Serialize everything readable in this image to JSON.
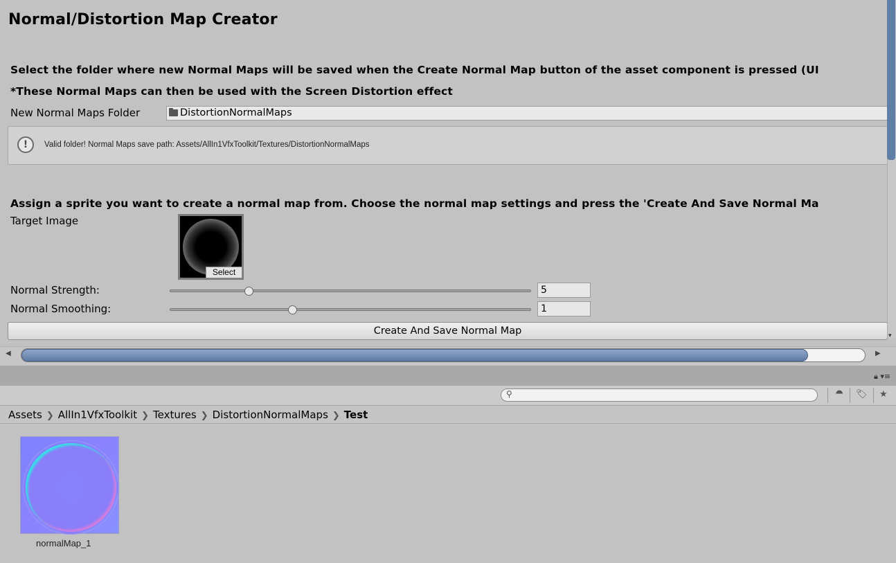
{
  "inspector": {
    "title": "Normal/Distortion Map Creator",
    "instruction_line1": "Select the folder where new Normal Maps will be saved when the Create Normal Map button of the asset component is pressed (UI",
    "instruction_line2": "*These Normal Maps can then be used with the Screen Distortion effect",
    "folder_label": "New Normal Maps Folder",
    "folder_value": "DistortionNormalMaps",
    "help_message": "Valid folder! Normal Maps save path: Assets/AllIn1VfxToolkit/Textures/DistortionNormalMaps",
    "assign_instruction": "Assign a sprite you want to create a normal map from. Choose the normal map settings and press the 'Create And Save Normal Ma",
    "target_image_label": "Target Image",
    "select_label": "Select",
    "strength_label": "Normal Strength:",
    "strength_value": "5",
    "smoothing_label": "Normal Smoothing:",
    "smoothing_value": "1",
    "create_button_label": "Create And Save Normal Map"
  },
  "sliders": {
    "strength_fraction": 0.22,
    "smoothing_fraction": 0.34
  },
  "project": {
    "breadcrumb": [
      "Assets",
      "AllIn1VfxToolkit",
      "Textures",
      "DistortionNormalMaps",
      "Test"
    ],
    "search_placeholder": "",
    "assets": [
      {
        "name": "normalMap_1"
      }
    ]
  },
  "icons": {
    "info": "info-icon",
    "folder": "folder-icon",
    "search": "search-icon",
    "lock": "lock-icon",
    "filter_type": "filter-type-icon",
    "filter_label": "label-icon",
    "favorite": "star-icon"
  }
}
